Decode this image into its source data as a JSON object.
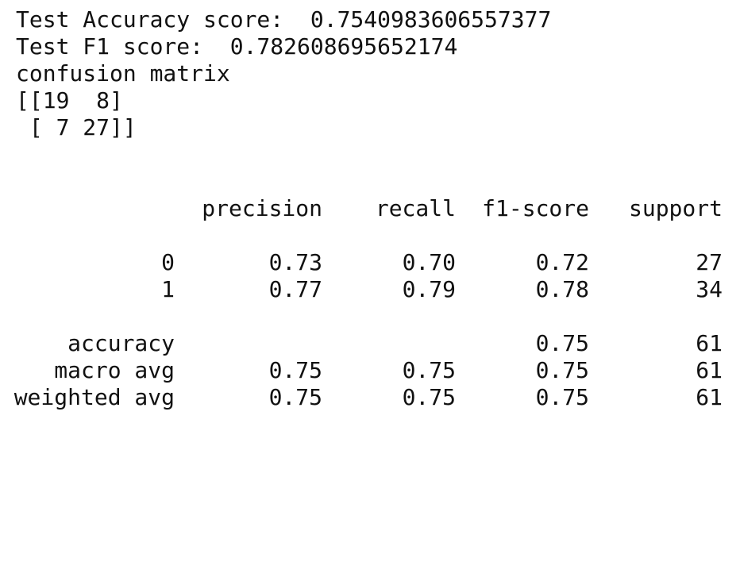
{
  "output": {
    "accuracy_line": "Test Accuracy score:  0.7540983606557377",
    "f1_line": "Test F1 score:  0.782608695652174",
    "confusion_title": "confusion matrix",
    "matrix_row_1": "[[19  8]",
    "matrix_row_2": " [ 7 27]]"
  },
  "report": {
    "headers": [
      "precision",
      "recall",
      "f1-score",
      "support"
    ],
    "rows": [
      {
        "label": "0",
        "precision": "0.73",
        "recall": "0.70",
        "f1": "0.72",
        "support": "27"
      },
      {
        "label": "1",
        "precision": "0.77",
        "recall": "0.79",
        "f1": "0.78",
        "support": "34"
      },
      {
        "label": "accuracy",
        "precision": "",
        "recall": "",
        "f1": "0.75",
        "support": "61"
      },
      {
        "label": "macro avg",
        "precision": "0.75",
        "recall": "0.75",
        "f1": "0.75",
        "support": "61"
      },
      {
        "label": "weighted avg",
        "precision": "0.75",
        "recall": "0.75",
        "f1": "0.75",
        "support": "61"
      }
    ]
  }
}
